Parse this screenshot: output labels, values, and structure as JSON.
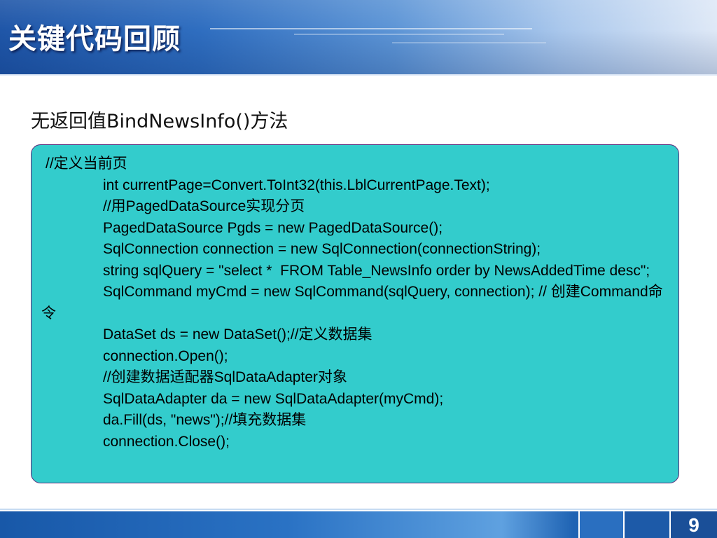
{
  "slide": {
    "title": "关键代码回顾",
    "subtitle": "无返回值BindNewsInfo()方法",
    "page_number": "9"
  },
  "code_lines": [
    "//定义当前页",
    "int currentPage=Convert.ToInt32(this.LblCurrentPage.Text);",
    "//用PagedDataSource实现分页",
    "PagedDataSource Pgds = new PagedDataSource();",
    "SqlConnection connection = new SqlConnection(connectionString);",
    "string sqlQuery = \"select *  FROM Table_NewsInfo order by NewsAddedTime desc\";",
    "SqlCommand myCmd = new SqlCommand(sqlQuery, connection); // 创建Command命令",
    "DataSet ds = new DataSet();//定义数据集",
    "connection.Open();",
    "//创建数据适配器SqlDataAdapter对象",
    "SqlDataAdapter da = new SqlDataAdapter(myCmd);",
    "da.Fill(ds, \"news\");//填充数据集",
    "connection.Close();"
  ],
  "colors": {
    "code_background": "#33cccc",
    "code_border": "#5a2a7a",
    "header_blue": "#2f6ec0"
  }
}
